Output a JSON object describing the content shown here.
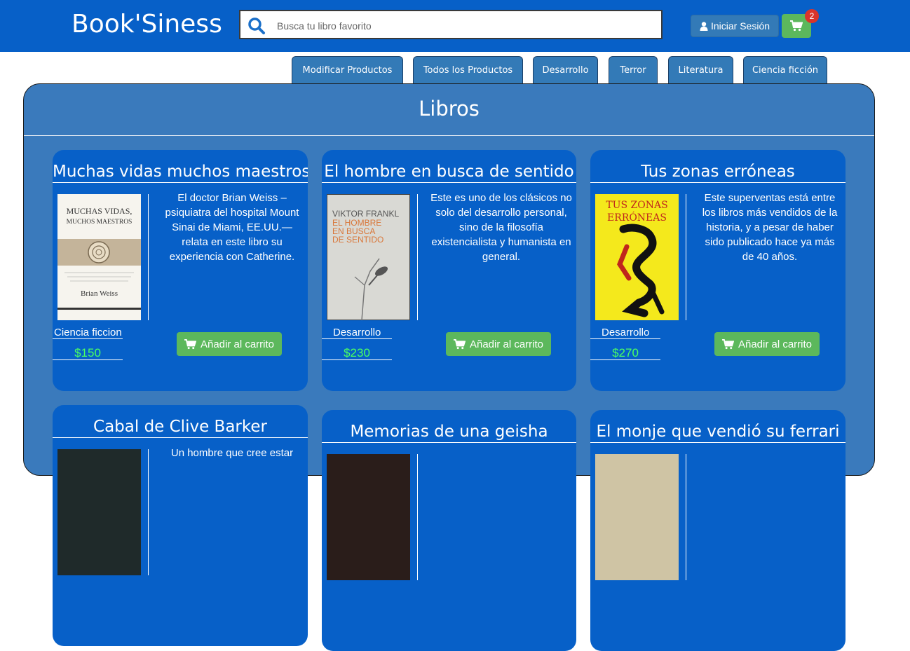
{
  "header": {
    "brand": "Book'Siness",
    "search_placeholder": "Busca tu libro favorito",
    "login_label": "Iniciar Sesión",
    "cart_count": "2"
  },
  "tabs": [
    {
      "label": "Modificar Productos"
    },
    {
      "label": "Todos los Productos"
    },
    {
      "label": "Desarrollo"
    },
    {
      "label": "Terror"
    },
    {
      "label": "Literatura"
    },
    {
      "label": "Ciencia ficción"
    }
  ],
  "main": {
    "title": "Libros",
    "add_label": "Añadir al carrito",
    "books": [
      {
        "title": "Muchas vidas muchos maestros",
        "description": "El doctor Brian Weiss –psiquiatra del hospital Mount Sinai de Miami, EE.UU.— relata en este libro su experiencia con Catherine.",
        "category": "Ciencia ficcion",
        "price": "$150",
        "cover": {
          "line1": "MUCHAS VIDAS,",
          "line2": "MUCHOS MAESTROS",
          "author": "Brian Weiss"
        }
      },
      {
        "title": "El hombre en busca de sentido",
        "description": "Este es uno de los clásicos no solo del desarrollo personal, sino de la filosofía existencialista y humanista en general.",
        "category": "Desarrollo",
        "price": "$230",
        "cover": {
          "line1": "VIKTOR FRANKL",
          "line2": "EL HOMBRE",
          "line3": "EN BUSCA",
          "line4": "DE SENTIDO"
        }
      },
      {
        "title": "Tus zonas erróneas",
        "description": "Este superventas está entre los libros más vendidos de la historia, y a pesar de haber sido publicado hace ya más de 40 años.",
        "category": "Desarrollo",
        "price": "$270",
        "cover": {
          "line1": "TUS ZONAS",
          "line2": "ERRÓNEAS"
        }
      },
      {
        "title": "Cabal de Clive Barker",
        "description": "Un hombre que cree estar"
      },
      {
        "title": "Memorias de una geisha"
      },
      {
        "title": "El monje que vendió su ferrari"
      }
    ]
  }
}
